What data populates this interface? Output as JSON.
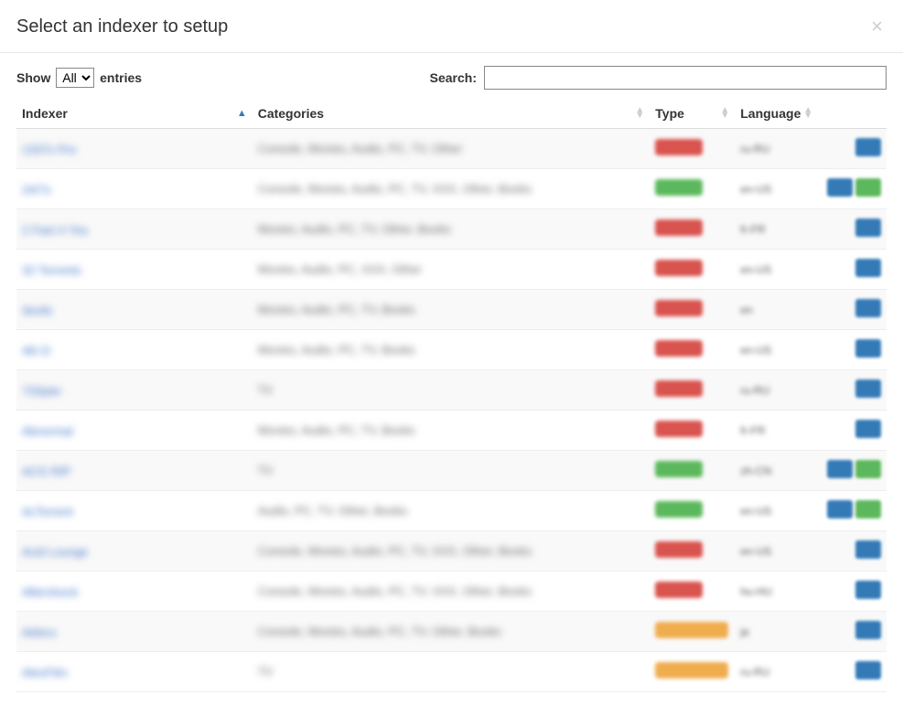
{
  "modal": {
    "title": "Select an indexer to setup",
    "close": "×"
  },
  "table_controls": {
    "show_label_pre": "Show",
    "show_label_post": "entries",
    "select_value": "All",
    "search_label": "Search:"
  },
  "columns": {
    "indexer": "Indexer",
    "categories": "Categories",
    "type": "Type",
    "language": "Language"
  },
  "rows": [
    {
      "name": "1337x Pro",
      "categories": "Console, Movies, Audio, PC, TV, Other",
      "type": "red",
      "lang": "ru-RU",
      "actions": [
        "blue"
      ]
    },
    {
      "name": "24/7x",
      "categories": "Console, Movies, Audio, PC, TV, XXX, Other, Books",
      "type": "green",
      "lang": "en-US",
      "actions": [
        "blue",
        "green"
      ]
    },
    {
      "name": "2 Fast 4 You",
      "categories": "Movies, Audio, PC, TV, Other, Books",
      "type": "red",
      "lang": "fr-FR",
      "actions": [
        "blue"
      ]
    },
    {
      "name": "32 Torrents",
      "categories": "Movies, Audio, PC, XXX, Other",
      "type": "red",
      "lang": "en-US",
      "actions": [
        "blue"
      ]
    },
    {
      "name": "3evils",
      "categories": "Movies, Audio, PC, TV, Books",
      "type": "red",
      "lang": "en",
      "actions": [
        "blue"
      ]
    },
    {
      "name": "4th D",
      "categories": "Movies, Audio, PC, TV, Books",
      "type": "red",
      "lang": "en-US",
      "actions": [
        "blue"
      ]
    },
    {
      "name": "720pier",
      "categories": "TV",
      "type": "red",
      "lang": "ru-RU",
      "actions": [
        "blue"
      ]
    },
    {
      "name": "Abnormal",
      "categories": "Movies, Audio, PC, TV, Books",
      "type": "red",
      "lang": "fr-FR",
      "actions": [
        "blue"
      ]
    },
    {
      "name": "ACG RIP",
      "categories": "TV",
      "type": "green",
      "lang": "zh-CN",
      "actions": [
        "blue",
        "green"
      ]
    },
    {
      "name": "AcTorrent",
      "categories": "Audio, PC, TV, Other, Books",
      "type": "green",
      "lang": "en-US",
      "actions": [
        "blue",
        "green"
      ]
    },
    {
      "name": "Acid Lounge",
      "categories": "Console, Movies, Audio, PC, TV, XXX, Other, Books",
      "type": "red",
      "lang": "en-US",
      "actions": [
        "blue"
      ]
    },
    {
      "name": "Aftershock",
      "categories": "Console, Movies, Audio, PC, TV, XXX, Other, Books",
      "type": "red",
      "lang": "hu-HU",
      "actions": [
        "blue"
      ]
    },
    {
      "name": "Aidoru",
      "categories": "Console, Movies, Audio, PC, TV, Other, Books",
      "type": "orange",
      "lang": "ja",
      "actions": [
        "blue"
      ]
    },
    {
      "name": "AlexFilm",
      "categories": "TV",
      "type": "orange",
      "lang": "ru-RU",
      "actions": [
        "blue"
      ]
    }
  ]
}
